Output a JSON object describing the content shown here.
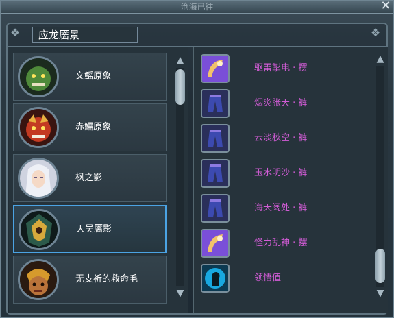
{
  "window": {
    "title": "沧海已往"
  },
  "header": {
    "label": "应龙靥景"
  },
  "list": [
    {
      "name": "文鳐原象",
      "avatar": "green-beast-portrait"
    },
    {
      "name": "赤鱬原象",
      "avatar": "red-beast-portrait"
    },
    {
      "name": "枫之影",
      "avatar": "white-hair-character-portrait"
    },
    {
      "name": "天吴靥影",
      "avatar": "armored-figure-portrait"
    },
    {
      "name": "无支祈的救命毛",
      "avatar": "monkey-portrait"
    }
  ],
  "selected_index": 3,
  "rewards": [
    {
      "label": "驱雷掣电 · 摆",
      "icon": "fan-icon"
    },
    {
      "label": "烟炎张天 · 裤",
      "icon": "pants-icon"
    },
    {
      "label": "云淡秋空 · 裤",
      "icon": "pants-icon"
    },
    {
      "label": "玉水明沙 · 裤",
      "icon": "pants-icon"
    },
    {
      "label": "海天阔处 · 裤",
      "icon": "pants-icon"
    },
    {
      "label": "怪力乱神 · 摆",
      "icon": "fan-icon"
    },
    {
      "label": "领悟值",
      "icon": "silhouette-icon"
    }
  ],
  "colors": {
    "accent": "#4ba3e3",
    "reward_text": "#d25cd6"
  }
}
